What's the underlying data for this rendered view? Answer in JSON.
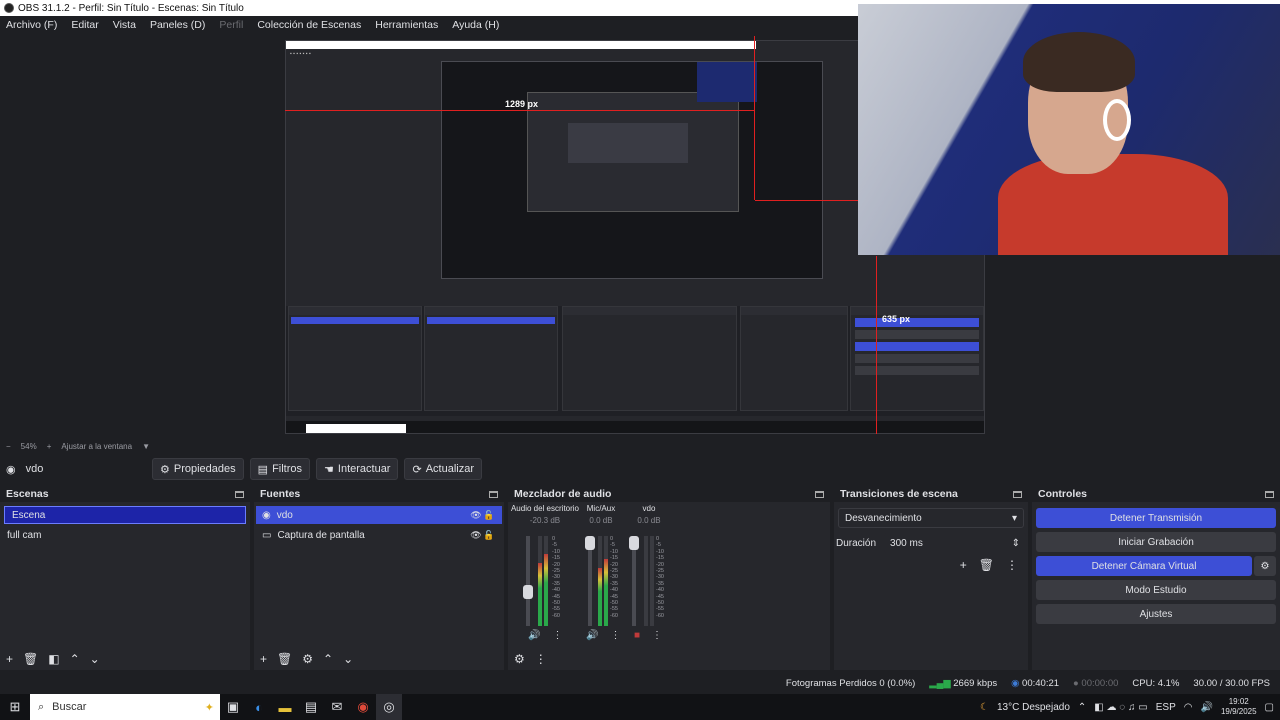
{
  "window": {
    "title": "OBS 31.1.2 - Perfil: Sin Título - Escenas: Sin Título"
  },
  "menu": [
    "Archivo (F)",
    "Editar",
    "Vista",
    "Paneles (D)",
    "Perfil",
    "Colección de Escenas",
    "Herramientas",
    "Ayuda (H)"
  ],
  "preview": {
    "measure_top": "1289 px",
    "measure_right": "635 px"
  },
  "zoom": {
    "percent": "54%",
    "fit_label": "Ajustar a la ventana"
  },
  "source_toolbar": {
    "source_name": "vdo",
    "buttons": [
      "Propiedades",
      "Filtros",
      "Interactuar",
      "Actualizar"
    ]
  },
  "scenes": {
    "title": "Escenas",
    "items": [
      "Escena",
      "full cam"
    ],
    "selected": "Escena"
  },
  "sources": {
    "title": "Fuentes",
    "items": [
      "vdo",
      "Captura de pantalla"
    ]
  },
  "mixer": {
    "title": "Mezclador de audio",
    "channels": [
      {
        "name": "Audio del escritorio",
        "db": "-20.3 dB",
        "level": 0.35
      },
      {
        "name": "Mic/Aux",
        "db": "0.0 dB",
        "level": 1.0
      },
      {
        "name": "vdo",
        "db": "0.0 dB",
        "level": 1.0
      }
    ],
    "scale": [
      "0",
      "-5",
      "-10",
      "-15",
      "-20",
      "-25",
      "-30",
      "-35",
      "-40",
      "-45",
      "-50",
      "-55",
      "-60"
    ]
  },
  "transitions": {
    "title": "Transiciones de escena",
    "selected": "Desvanecimiento",
    "duration_label": "Duración",
    "duration_value": "300 ms"
  },
  "controls": {
    "title": "Controles",
    "stop_stream": "Detener Transmisión",
    "start_recording": "Iniciar Grabación",
    "stop_virtual_cam": "Detener Cámara Virtual",
    "studio_mode": "Modo Estudio",
    "settings": "Ajustes"
  },
  "status": {
    "dropped_frames": "Fotogramas Perdidos 0 (0.0%)",
    "bitrate": "2669 kbps",
    "stream_time": "00:40:21",
    "rec_time": "00:00:00",
    "cpu": "CPU: 4.1%",
    "fps": "30.00 / 30.00 FPS"
  },
  "taskbar": {
    "search_placeholder": "Buscar",
    "weather": "13°C  Despejado",
    "language": "ESP",
    "time": "19:02",
    "date": "19/9/2025"
  }
}
